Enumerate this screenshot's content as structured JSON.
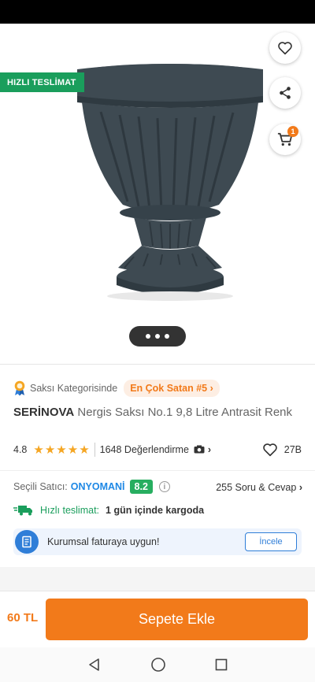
{
  "header": {
    "fast_delivery_badge": "HIZLI TESLİMAT",
    "cart_count": "1"
  },
  "gallery": {
    "image_count": 3,
    "active_index": 0
  },
  "category": {
    "text": "Saksı Kategorisinde",
    "bestseller": "En Çok Satan #5"
  },
  "product": {
    "brand": "SERİNOVA",
    "name": "Nergis Saksı No.1 9,8 Litre Antrasit Renk",
    "rating": "4.8",
    "stars": 5,
    "reviews": "1648 Değerlendirme",
    "likes": "27B",
    "color": "#3e4a52"
  },
  "seller": {
    "label": "Seçili Satıcı:",
    "name": "ONYOMANİ",
    "score": "8.2",
    "qa": "255 Soru & Cevap"
  },
  "delivery": {
    "label": "Hızlı teslimat:",
    "value": "1 gün içinde kargoda"
  },
  "invoice": {
    "text": "Kurumsal faturaya uygun!",
    "button": "İncele"
  },
  "purchase": {
    "price": "60 TL",
    "add_to_cart": "Sepete Ekle"
  },
  "colors": {
    "accent": "#f27a1a",
    "green": "#1a9e5c",
    "blue": "#2f7ed8"
  }
}
